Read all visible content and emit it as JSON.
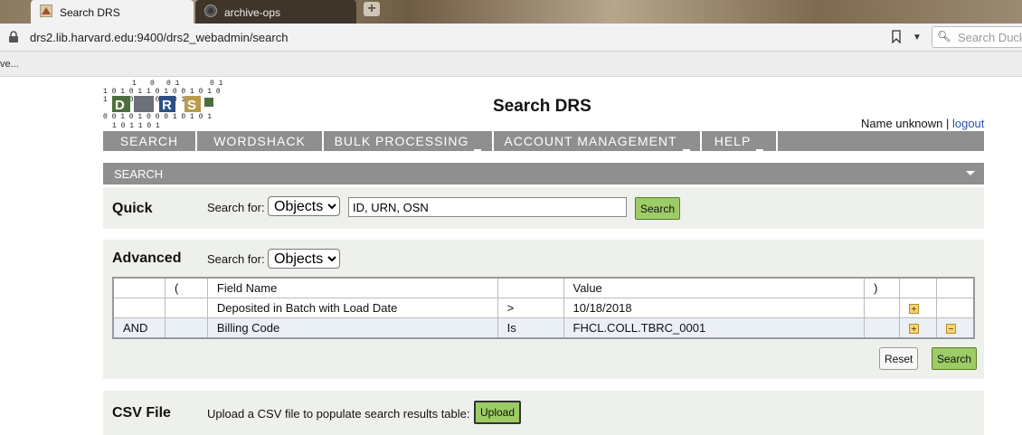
{
  "browser": {
    "tabs": [
      {
        "label": "Search DRS",
        "active": true
      },
      {
        "label": "archive-ops",
        "active": false
      }
    ],
    "url": "drs2.lib.harvard.edu:9400/drs2_webadmin/search",
    "search_placeholder": "Search DuckDuckGo",
    "bookmarks_bar_text": "ve..."
  },
  "header": {
    "logo_letters": [
      "D",
      "R",
      "S"
    ],
    "title": "Search DRS",
    "user_name": "Name unknown",
    "separator": "|",
    "logout_label": "logout"
  },
  "nav": {
    "items": [
      {
        "label": "SEARCH",
        "has_menu": false
      },
      {
        "label": "WORDSHACK",
        "has_menu": false
      },
      {
        "label": "BULK PROCESSING",
        "has_menu": true
      },
      {
        "label": "ACCOUNT MANAGEMENT",
        "has_menu": true
      },
      {
        "label": "HELP",
        "has_menu": true
      }
    ]
  },
  "section": {
    "label": "SEARCH"
  },
  "quick": {
    "title": "Quick",
    "search_for_label": "Search for:",
    "select_value": "Objects",
    "input_value": "ID, URN, OSN",
    "search_button": "Search"
  },
  "advanced": {
    "title": "Advanced",
    "search_for_label": "Search for:",
    "select_value": "Objects",
    "headers": [
      "",
      "(",
      "Field Name",
      "",
      "Value",
      ")",
      "",
      ""
    ],
    "rows": [
      {
        "bool": "",
        "open": "",
        "field": "Deposited in Batch with Load Date",
        "op": ">",
        "value": "10/18/2018",
        "close": ""
      },
      {
        "bool": "AND",
        "open": "",
        "field": "Billing Code",
        "op": "Is",
        "value": "FHCL.COLL.TBRC_0001",
        "close": ""
      }
    ],
    "reset_button": "Reset",
    "search_button": "Search"
  },
  "csv": {
    "title": "CSV File",
    "text": "Upload a CSV file to populate search results table:",
    "upload_button": "Upload"
  },
  "colors": {
    "nav_gray": "#8f8f8f",
    "panel_bg": "#eef1eb",
    "button_green": "#9ccc65",
    "link_blue": "#2a4fae"
  }
}
